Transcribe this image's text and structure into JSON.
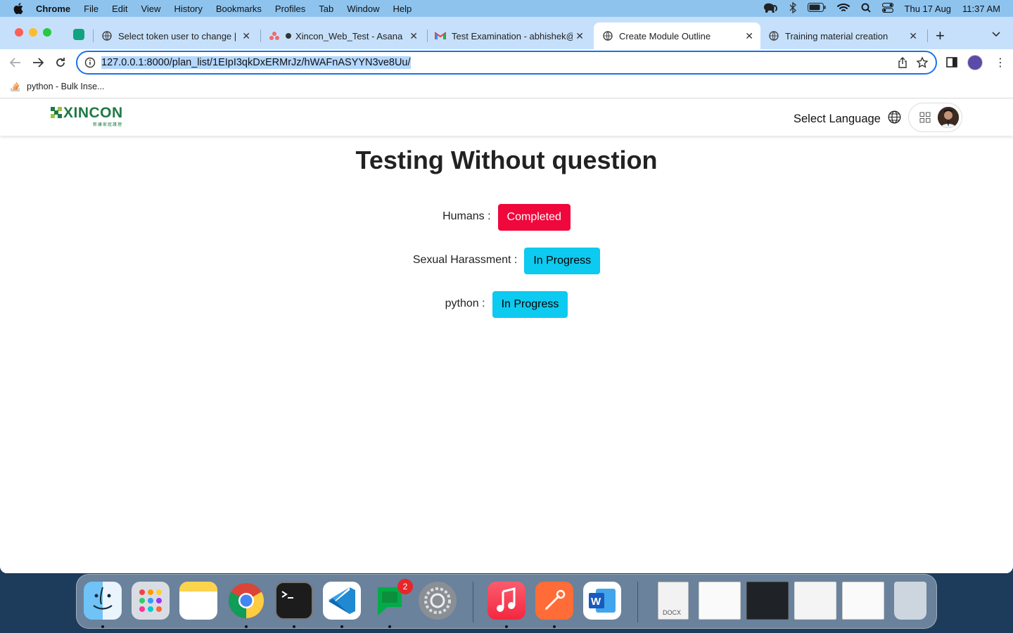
{
  "menubar": {
    "app": "Chrome",
    "items": [
      "File",
      "Edit",
      "View",
      "History",
      "Bookmarks",
      "Profiles",
      "Tab",
      "Window",
      "Help"
    ],
    "date": "Thu 17 Aug",
    "time": "11:37 AM"
  },
  "tabs": [
    {
      "title": "Select token user to change | D",
      "icon": "globe-icon"
    },
    {
      "title": "Xincon_Web_Test - Asana",
      "icon": "asana-icon"
    },
    {
      "title": "Test Examination - abhishek@",
      "icon": "gmail-icon"
    },
    {
      "title": "Create Module Outline",
      "icon": "globe-icon",
      "active": true
    },
    {
      "title": "Training material creation",
      "icon": "globe-icon"
    }
  ],
  "address_bar": {
    "url": "127.0.0.1:8000/plan_list/1EIpI3qkDxERMrJz/hWAFnASYYN3ve8Uu/"
  },
  "bookmarks": [
    {
      "label": "python - Bulk Inse..."
    }
  ],
  "site": {
    "logo_text": "XINCON",
    "logo_sub": "新康家庭護理",
    "language_label": "Select Language"
  },
  "main": {
    "title": "Testing Without question",
    "modules": [
      {
        "label": "Humans :",
        "status": "Completed"
      },
      {
        "label": "Sexual Harassment :",
        "status": "In Progress"
      },
      {
        "label": "python :",
        "status": "In Progress"
      }
    ]
  },
  "colors": {
    "completed": "#f0073b",
    "in_progress": "#0dcaf0",
    "brand": "#1e7a45"
  },
  "dock": {
    "apps": [
      "Finder",
      "Launchpad",
      "Notes",
      "Google Chrome",
      "Terminal",
      "Visual Studio Code",
      "Google Chat",
      "System Settings",
      "Music",
      "Postman",
      "Microsoft Word"
    ],
    "chat_badge": "2",
    "doc_label": "DOCX"
  }
}
